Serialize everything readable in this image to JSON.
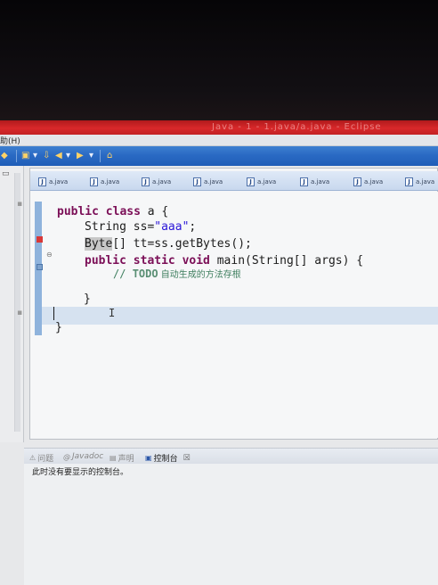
{
  "window": {
    "title": "Java - 1 - 1.java/a.java - Eclipse"
  },
  "menubar": {
    "help_label": "助(H)"
  },
  "editor_tabs": [
    {
      "label": "a.java"
    },
    {
      "label": "a.java"
    },
    {
      "label": "a.java"
    },
    {
      "label": "a.java"
    },
    {
      "label": "a.java"
    },
    {
      "label": "a.java"
    },
    {
      "label": "a.java"
    },
    {
      "label": "a.java"
    }
  ],
  "code": {
    "line1": {
      "kw": "public class",
      "rest": " a {"
    },
    "line2": {
      "type": "String",
      "var": " ss=",
      "str": "\"aaa\"",
      "end": ";"
    },
    "line3": {
      "type": "Byte",
      "rest": "[] tt=ss.getBytes();"
    },
    "line4": {
      "kw": "public static void",
      "rest": " main(String[] args) {"
    },
    "line5": {
      "cmt": "// ",
      "todo": "TODO",
      "note": " 自动生成的方法存根"
    },
    "line6": {
      "text": "}"
    },
    "line8": {
      "text": "}"
    }
  },
  "bottom_panel": {
    "tabs": [
      {
        "label": "问题",
        "icon": "problems-icon",
        "active": false
      },
      {
        "label": "Javadoc",
        "icon": "javadoc-icon",
        "active": false
      },
      {
        "label": "声明",
        "icon": "declaration-icon",
        "active": false
      },
      {
        "label": "控制台",
        "icon": "console-icon",
        "active": true
      }
    ],
    "close_glyph": "☒",
    "console_message": "此时没有要显示的控制台。"
  },
  "colors": {
    "titlebar": "#d8282a",
    "toolbar": "#2a6ac4",
    "keyword": "#7b0f57",
    "string": "#2a16d8",
    "comment": "#3f7f5f"
  }
}
